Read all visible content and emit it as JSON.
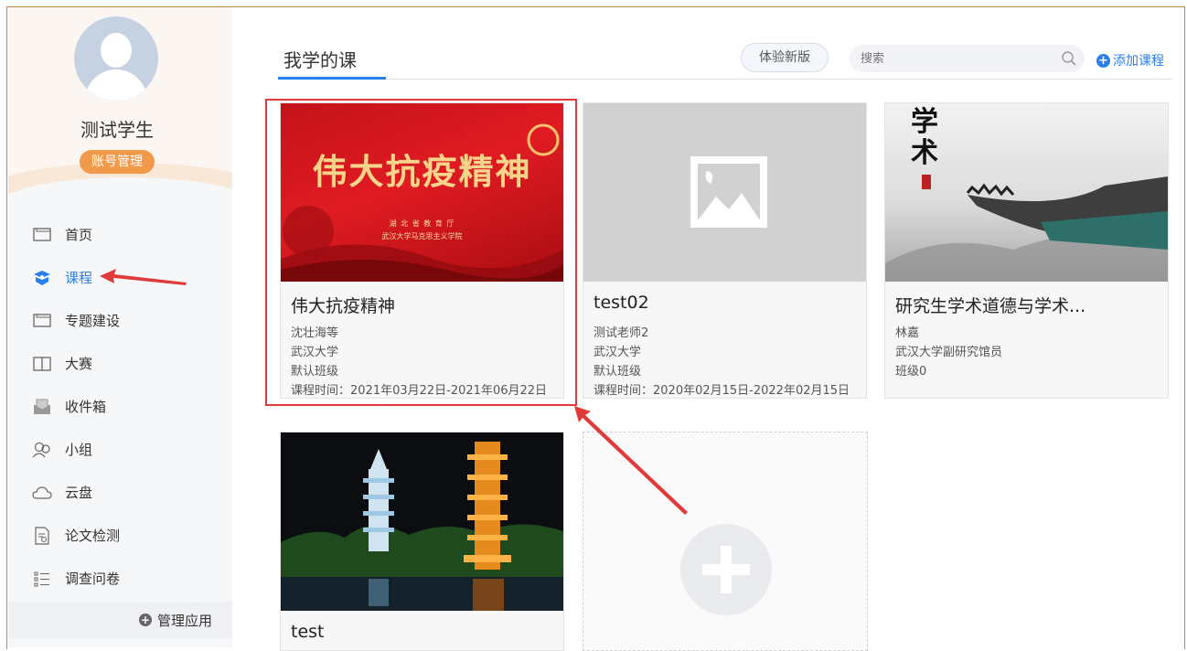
{
  "sidebar": {
    "username": "测试学生",
    "account_button": "账号管理",
    "nav": [
      {
        "label": "首页",
        "icon": "monitor-icon"
      },
      {
        "label": "课程",
        "icon": "course-icon",
        "active": true
      },
      {
        "label": "专题建设",
        "icon": "monitor-icon"
      },
      {
        "label": "大赛",
        "icon": "book-icon"
      },
      {
        "label": "收件箱",
        "icon": "inbox-icon"
      },
      {
        "label": "小组",
        "icon": "group-icon"
      },
      {
        "label": "云盘",
        "icon": "cloud-icon"
      },
      {
        "label": "论文检测",
        "icon": "document-check-icon"
      },
      {
        "label": "调查问卷",
        "icon": "list-icon"
      }
    ],
    "manage_apps": "管理应用"
  },
  "header": {
    "tab": "我学的课",
    "try_new": "体验新版",
    "search_placeholder": "搜索",
    "add_course": "添加课程"
  },
  "courses": [
    {
      "title": "伟大抗疫精神",
      "teacher": "沈壮海等",
      "school": "武汉大学",
      "class": "默认班级",
      "time": "课程时间：2021年03月22日-2021年06月22日",
      "cover": {
        "headline": "伟大抗疫精神",
        "line1": "湖 北 省 教 育 厅",
        "line2": "武汉大学马克思主义学院"
      }
    },
    {
      "title": "test02",
      "teacher": "测试老师2",
      "school": "武汉大学",
      "class": "默认班级",
      "time": "课程时间：2020年02月15日-2022年02月15日"
    },
    {
      "title": "研究生学术道德与学术...",
      "teacher": "林嘉",
      "school": "武汉大学副研究馆员",
      "class": "班级0",
      "cover": {
        "calligraphy": "学术"
      }
    },
    {
      "title": "test"
    }
  ],
  "colors": {
    "accent": "#2a80eb",
    "annotation": "#e03b3b",
    "account_button": "#f29a4b"
  }
}
